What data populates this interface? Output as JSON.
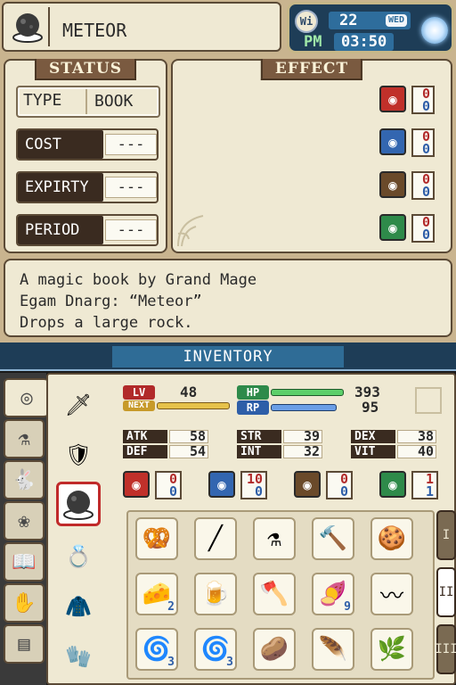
{
  "header": {
    "item_name": "METEOR",
    "item_icon": "meteor-book-icon"
  },
  "clock": {
    "wifi": "Wi",
    "day": "22",
    "weekday": "WED",
    "ampm": "PM",
    "time": "03:50"
  },
  "status": {
    "title": "STATUS",
    "type_label": "TYPE",
    "type_value": "BOOK",
    "rows": [
      {
        "label": "COST",
        "value": "---"
      },
      {
        "label": "EXPIRTY",
        "value": "---"
      },
      {
        "label": "PERIOD",
        "value": "---"
      }
    ]
  },
  "effect": {
    "title": "EFFECT",
    "elements": [
      {
        "icon": "fire-element-icon",
        "color": "#c0302a",
        "a": "0",
        "b": "0"
      },
      {
        "icon": "water-element-icon",
        "color": "#3366b0",
        "a": "0",
        "b": "0"
      },
      {
        "icon": "earth-element-icon",
        "color": "#6a4a2a",
        "a": "0",
        "b": "0"
      },
      {
        "icon": "wind-element-icon",
        "color": "#2e8a4a",
        "a": "0",
        "b": "0"
      }
    ]
  },
  "description": {
    "lines": [
      "A magic book by Grand Mage",
      "Egam Dnarg: “Meteor”",
      "Drops a large rock."
    ]
  },
  "inventory": {
    "title": "INVENTORY",
    "bars": {
      "lv": {
        "label": "LV",
        "value": "48"
      },
      "next": {
        "label": "NEXT"
      },
      "hp": {
        "label": "HP",
        "value": "393",
        "fill_fraction": 1.0
      },
      "rp": {
        "label": "RP",
        "value": "95",
        "fill_fraction": 0.9
      }
    },
    "stats": [
      {
        "label": "ATK",
        "value": "58"
      },
      {
        "label": "STR",
        "value": "39"
      },
      {
        "label": "DEX",
        "value": "38"
      },
      {
        "label": "DEF",
        "value": "54"
      },
      {
        "label": "INT",
        "value": "32"
      },
      {
        "label": "VIT",
        "value": "40"
      }
    ],
    "resists": [
      {
        "icon": "fire-element-icon",
        "color": "#c0302a",
        "a": "0",
        "b": "0"
      },
      {
        "icon": "water-element-icon",
        "color": "#3366b0",
        "a": "10",
        "b": "0"
      },
      {
        "icon": "earth-element-icon",
        "color": "#6a4a2a",
        "a": "0",
        "b": "0"
      },
      {
        "icon": "wind-element-icon",
        "color": "#2e8a4a",
        "a": "1",
        "b": "1"
      }
    ],
    "items": [
      {
        "name": "pretzel-plate-icon",
        "glyph": "🥨",
        "count": ""
      },
      {
        "name": "stick-icon",
        "glyph": "╱",
        "count": ""
      },
      {
        "name": "flask-icon",
        "glyph": "⚗",
        "count": ""
      },
      {
        "name": "hammer-icon",
        "glyph": "🔨",
        "count": ""
      },
      {
        "name": "cookie-bag-icon",
        "glyph": "🍪",
        "count": ""
      },
      {
        "name": "cheese-icon",
        "glyph": "🧀",
        "count": "2"
      },
      {
        "name": "mug-icon",
        "glyph": "🍺",
        "count": ""
      },
      {
        "name": "axe-icon",
        "glyph": "🪓",
        "count": ""
      },
      {
        "name": "sweet-potato-icon",
        "glyph": "🍠",
        "count": "9"
      },
      {
        "name": "horn-icon",
        "glyph": "〰",
        "count": ""
      },
      {
        "name": "silk-icon",
        "glyph": "🌀",
        "count": "3"
      },
      {
        "name": "silk-gray-icon",
        "glyph": "🌀",
        "count": "3"
      },
      {
        "name": "brush-icon",
        "glyph": "🥔",
        "count": ""
      },
      {
        "name": "feather-icon",
        "glyph": "🪶",
        "count": ""
      },
      {
        "name": "herb-icon",
        "glyph": "🌿",
        "count": ""
      }
    ],
    "pages": [
      "I",
      "II",
      "III"
    ]
  }
}
